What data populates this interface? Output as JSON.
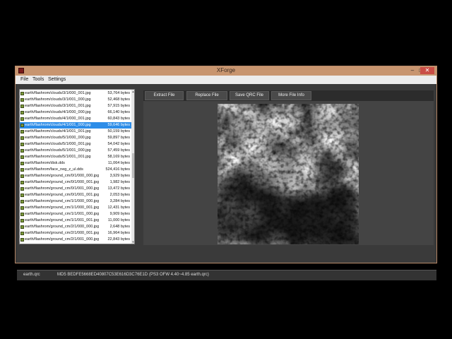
{
  "window": {
    "title": "XForge",
    "min": "–",
    "max": "□",
    "close": "✕"
  },
  "menu": [
    {
      "label": "File"
    },
    {
      "label": "Tools"
    },
    {
      "label": "Settings"
    }
  ],
  "files": [
    {
      "name": "earth/flashrom/clouds/3/1/000_001.jpg",
      "size": "53,764 bytes"
    },
    {
      "name": "earth/flashrom/clouds/3/1/001_000.jpg",
      "size": "52,468 bytes"
    },
    {
      "name": "earth/flashrom/clouds/3/1/001_001.jpg",
      "size": "57,915 bytes"
    },
    {
      "name": "earth/flashrom/clouds/4/1/000_000.jpg",
      "size": "66,140 bytes"
    },
    {
      "name": "earth/flashrom/clouds/4/1/000_001.jpg",
      "size": "60,843 bytes"
    },
    {
      "name": "earth/flashrom/clouds/4/1/001_000.jpg",
      "size": "59,646 bytes",
      "selected": true
    },
    {
      "name": "earth/flashrom/clouds/4/1/001_001.jpg",
      "size": "50,159 bytes"
    },
    {
      "name": "earth/flashrom/clouds/5/1/000_000.jpg",
      "size": "59,897 bytes"
    },
    {
      "name": "earth/flashrom/clouds/5/1/000_001.jpg",
      "size": "54,042 bytes"
    },
    {
      "name": "earth/flashrom/clouds/5/1/001_000.jpg",
      "size": "57,459 bytes"
    },
    {
      "name": "earth/flashrom/clouds/5/1/001_001.jpg",
      "size": "58,169 bytes"
    },
    {
      "name": "earth/flashrom/disk.dds",
      "size": "11,064 bytes"
    },
    {
      "name": "earth/flashrom/face_neg_z_ul.dds",
      "size": "524,416 bytes"
    },
    {
      "name": "earth/flashrom/ground_cm/0/1/000_000.jpg",
      "size": "3,929 bytes"
    },
    {
      "name": "earth/flashrom/ground_cm/0/1/000_001.jpg",
      "size": "1,982 bytes"
    },
    {
      "name": "earth/flashrom/ground_cm/0/1/001_000.jpg",
      "size": "13,472 bytes"
    },
    {
      "name": "earth/flashrom/ground_cm/0/1/001_001.jpg",
      "size": "2,053 bytes"
    },
    {
      "name": "earth/flashrom/ground_cm/1/1/000_000.jpg",
      "size": "3,284 bytes"
    },
    {
      "name": "earth/flashrom/ground_cm/1/1/000_001.jpg",
      "size": "12,431 bytes"
    },
    {
      "name": "earth/flashrom/ground_cm/1/1/001_000.jpg",
      "size": "9,909 bytes"
    },
    {
      "name": "earth/flashrom/ground_cm/1/1/001_001.jpg",
      "size": "11,000 bytes"
    },
    {
      "name": "earth/flashrom/ground_cm/2/1/000_000.jpg",
      "size": "2,648 bytes"
    },
    {
      "name": "earth/flashrom/ground_cm/2/1/000_001.jpg",
      "size": "16,964 bytes"
    },
    {
      "name": "earth/flashrom/ground_cm/2/1/001_000.jpg",
      "size": "22,843 bytes"
    }
  ],
  "toolbar": {
    "extract": "Extract File",
    "replace": "Replace File",
    "save": "Save QRC File",
    "info": "More File Info"
  },
  "status": {
    "file": "earth.qrc",
    "md5": "MD5 BEDFE5668ED40807C53E616D3C76E1D",
    "version": "(PS3 OFW 4.40~4.85 earth.qrc)"
  }
}
